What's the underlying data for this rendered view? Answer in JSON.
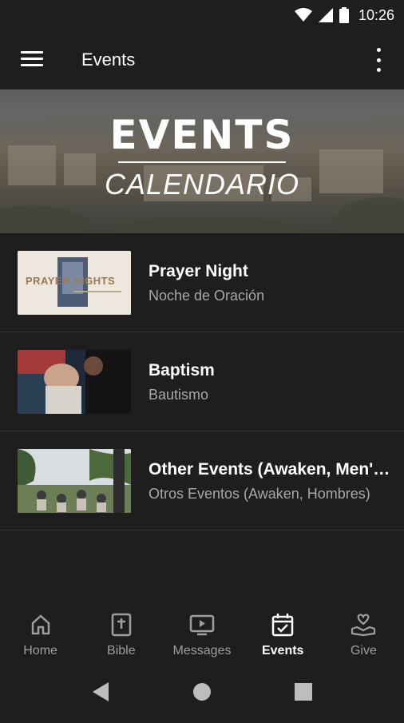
{
  "status_bar": {
    "time": "10:26",
    "icons": [
      "wifi-icon",
      "signal-icon",
      "battery-icon"
    ]
  },
  "app_bar": {
    "title": "Events",
    "menu_icon": "menu-icon",
    "more_icon": "more-vert-icon"
  },
  "banner": {
    "title": "EVENTS",
    "subtitle": "CALENDARIO"
  },
  "events": [
    {
      "title": "Prayer Night",
      "subtitle": "Noche de Oración",
      "thumb_text": "PRAYER NIGHTS"
    },
    {
      "title": "Baptism",
      "subtitle": "Bautismo"
    },
    {
      "title": "Other Events (Awaken, Men's Group)",
      "subtitle": "Otros Eventos (Awaken, Hombres)"
    }
  ],
  "bottom_nav": [
    {
      "label": "Home",
      "icon": "home-icon",
      "active": false
    },
    {
      "label": "Bible",
      "icon": "bible-icon",
      "active": false
    },
    {
      "label": "Messages",
      "icon": "tv-play-icon",
      "active": false
    },
    {
      "label": "Events",
      "icon": "calendar-check-icon",
      "active": true
    },
    {
      "label": "Give",
      "icon": "hand-heart-icon",
      "active": false
    }
  ],
  "system_nav": [
    "back-icon",
    "home-circle-icon",
    "recents-icon"
  ]
}
